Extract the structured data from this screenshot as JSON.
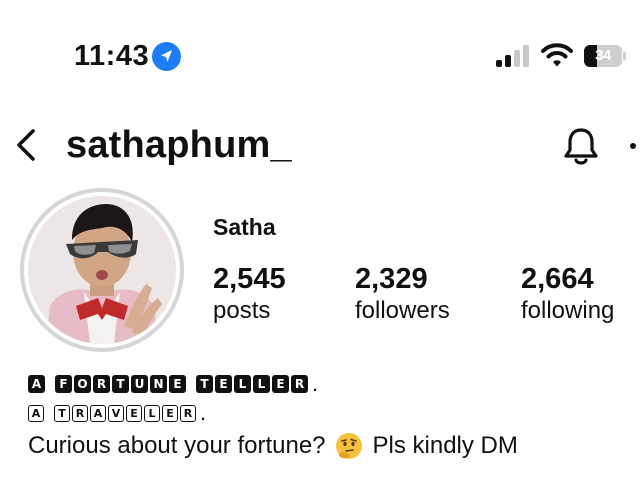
{
  "status_bar": {
    "time": "11:43",
    "battery": "34",
    "battery_level": 0.34
  },
  "header": {
    "username": "sathaphum_"
  },
  "profile": {
    "display_name": "Satha",
    "stats": [
      {
        "value": "2,545",
        "label": "posts"
      },
      {
        "value": "2,329",
        "label": "followers"
      },
      {
        "value": "2,664",
        "label": "following"
      }
    ]
  },
  "bio": {
    "line1": "A FORTUNE TELLER.",
    "line2": "A TRAVELER.",
    "line3_before": "Curious about your fortune?",
    "line3_after": "Pls kindly DM"
  },
  "colors": {
    "accent": "#1e7cf7",
    "text": "#111111",
    "ring": "#d6d6d6"
  },
  "icons": [
    "location-arrow-icon",
    "cellular-signal-icon",
    "wifi-icon",
    "battery-icon",
    "back-chevron-icon",
    "bell-icon",
    "more-icon",
    "thinking-face-emoji"
  ]
}
